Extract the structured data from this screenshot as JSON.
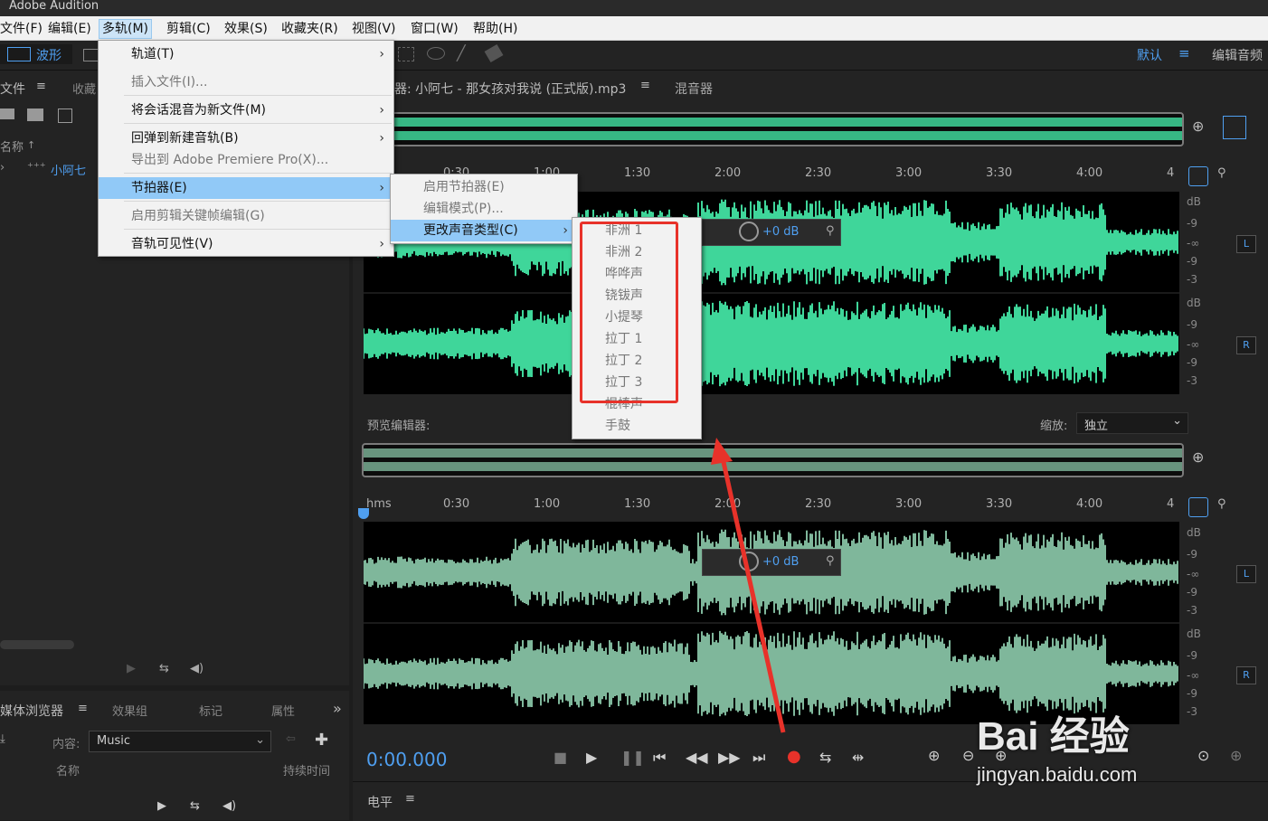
{
  "app_title": "Adobe Audition",
  "menubar": [
    "文件(F)",
    "编辑(E)",
    "多轨(M)",
    "剪辑(C)",
    "效果(S)",
    "收藏夹(R)",
    "视图(V)",
    "窗口(W)",
    "帮助(H)"
  ],
  "toolbar": {
    "waveform_label": "波形",
    "workspace": "默认",
    "edit_audio": "编辑音频"
  },
  "files_panel": {
    "tab_files": "文件",
    "tab_fav": "收藏",
    "col_name": "名称",
    "file_name": "小阿七"
  },
  "editor": {
    "tab_title": "器: 小阿七 - 那女孩对我说 (正式版).mp3",
    "tab_mixer": "混音器",
    "time_labels": [
      "0:30",
      "1:00",
      "1:30",
      "2:00",
      "2:30",
      "3:00",
      "3:30",
      "4:00",
      "4"
    ],
    "hms": "hms",
    "gain": "+0 dB",
    "db_labels": [
      "dB",
      "-9",
      "-∞",
      "-9",
      "-3"
    ],
    "left": "L",
    "right": "R"
  },
  "preview": {
    "label": "预览编辑器:",
    "zoom_label": "缩放:",
    "zoom_value": "独立"
  },
  "time_display": "0:00.000",
  "level_panel": "电平",
  "media_browser": {
    "tab": "媒体浏览器",
    "tab_fx": "效果组",
    "tab_markers": "标记",
    "tab_props": "属性",
    "content_label": "内容:",
    "content_value": "Music",
    "col_name": "名称",
    "col_duration": "持续时间"
  },
  "multitrack_menu": [
    {
      "label": "轨道(T)",
      "arrow": true,
      "disabled": false
    },
    {
      "label": "插入文件(I)...",
      "arrow": false,
      "disabled": true
    },
    {
      "label": "将会话混音为新文件(M)",
      "arrow": true,
      "disabled": false
    },
    {
      "label": "回弹到新建音轨(B)",
      "arrow": true,
      "disabled": false
    },
    {
      "label": "导出到 Adobe Premiere Pro(X)...",
      "arrow": false,
      "disabled": true
    },
    {
      "label": "节拍器(E)",
      "arrow": true,
      "disabled": false,
      "highlight": true
    },
    {
      "label": "启用剪辑关键帧编辑(G)",
      "arrow": false,
      "disabled": true
    },
    {
      "label": "音轨可见性(V)",
      "arrow": true,
      "disabled": false
    }
  ],
  "metronome_menu": [
    {
      "label": "启用节拍器(E)",
      "arrow": false,
      "disabled": true
    },
    {
      "label": "编辑模式(P)...",
      "arrow": false,
      "disabled": true
    },
    {
      "label": "更改声音类型(C)",
      "arrow": true,
      "disabled": false,
      "highlight": true
    }
  ],
  "sound_types": [
    "非洲 1",
    "非洲 2",
    "哗哗声",
    "铙钹声",
    "小提琴",
    "拉丁 1",
    "拉丁 2",
    "拉丁 3",
    "棍棒声",
    "手鼓"
  ],
  "watermark": {
    "text": "Bai 经验",
    "url": "jingyan.baidu.com"
  },
  "colors": {
    "wave_main": "#3fd69a",
    "wave_preview": "#7fb79b",
    "accent": "#4f9ff0",
    "annotation": "#e8322a"
  }
}
